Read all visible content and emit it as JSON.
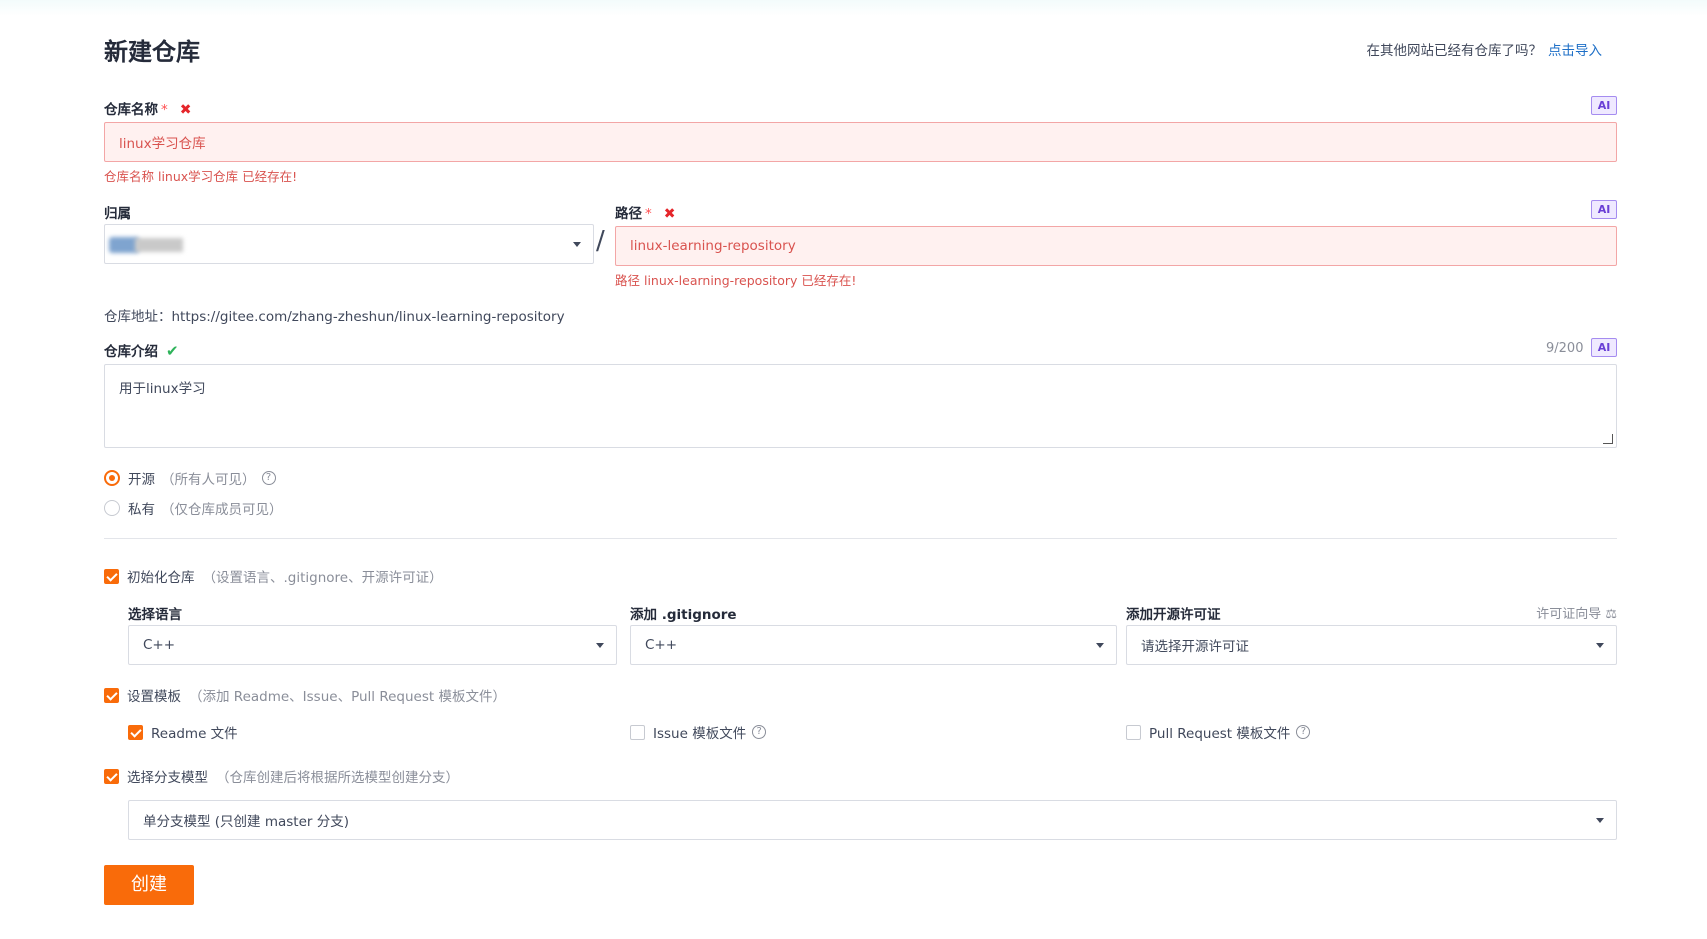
{
  "page": {
    "title": "新建仓库",
    "import_prompt": "在其他网站已经有仓库了吗？",
    "import_link": "点击导入"
  },
  "repo_name": {
    "label": "仓库名称",
    "required_mark": "*",
    "value": "linux学习仓库",
    "error": "仓库名称 linux学习仓库 已经存在!",
    "ai_badge": "AI"
  },
  "owner": {
    "label": "归属"
  },
  "separator": "/",
  "path": {
    "label": "路径",
    "required_mark": "*",
    "value": "linux-learning-repository",
    "error": "路径 linux-learning-repository 已经存在!",
    "ai_badge": "AI"
  },
  "repo_url": "仓库地址：https://gitee.com/zhang-zheshun/linux-learning-repository",
  "description": {
    "label": "仓库介绍",
    "counter": "9/200",
    "ai_badge": "AI",
    "value": "用于linux学习"
  },
  "visibility": {
    "public_label": "开源",
    "public_hint": "（所有人可见）",
    "private_label": "私有",
    "private_hint": "（仅仓库成员可见）",
    "selected": "public"
  },
  "init": {
    "label": "初始化仓库",
    "hint": "（设置语言、.gitignore、开源许可证）",
    "checked": true,
    "language_label": "选择语言",
    "language_value": "C++",
    "gitignore_label": "添加 .gitignore",
    "gitignore_value": "C++",
    "license_label": "添加开源许可证",
    "license_guide": "许可证向导 ⚖",
    "license_value": "请选择开源许可证"
  },
  "template": {
    "label": "设置模板",
    "hint": "（添加 Readme、Issue、Pull Request 模板文件）",
    "checked": true,
    "readme_label": "Readme 文件",
    "readme_checked": true,
    "issue_label": "Issue 模板文件",
    "issue_checked": false,
    "pr_label": "Pull Request 模板文件",
    "pr_checked": false
  },
  "branch": {
    "label": "选择分支模型",
    "hint": "（仓库创建后将根据所选模型创建分支）",
    "checked": true,
    "value": "单分支模型 (只创建 master 分支)"
  },
  "create_button": "创建",
  "icons": {
    "error": "close-icon",
    "ok": "check-icon",
    "help": "question-circle-icon",
    "dropdown": "caret-down-icon"
  },
  "colors": {
    "accent": "#f96b0a",
    "error": "#d9534f",
    "link": "#1e6fc7",
    "ai": "#6a3fd6"
  }
}
